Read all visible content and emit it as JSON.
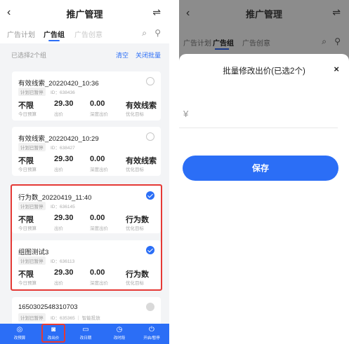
{
  "header": {
    "back_icon": "‹",
    "title": "推广管理",
    "swap_icon": "⇌"
  },
  "tabs": [
    {
      "label": "广告计划"
    },
    {
      "label": "广告组"
    },
    {
      "label": "广告创意"
    }
  ],
  "selection": {
    "count_text": "已选择2个组",
    "clear": "清空",
    "close": "关闭批量"
  },
  "cards": [
    {
      "name": "有效线索_20220420_10:36",
      "status": "计划已暂停",
      "id": "ID：638436",
      "budget": "不限",
      "budget_label": "今日预算",
      "bid": "29.30",
      "bid_label": "出价",
      "deep_bid": "0.00",
      "deep_label": "深度出价",
      "goal": "有效线索",
      "goal_label": "优化目标",
      "checked": false
    },
    {
      "name": "有效线索_20220420_10:29",
      "status": "计划已暂停",
      "id": "ID：638427",
      "budget": "不限",
      "budget_label": "今日预算",
      "bid": "29.30",
      "bid_label": "出价",
      "deep_bid": "0.00",
      "deep_label": "深度出价",
      "goal": "有效线索",
      "goal_label": "优化目标",
      "checked": false
    },
    {
      "name": "行为数_20220419_11:40",
      "status": "计划已暂停",
      "id": "ID：636145",
      "budget": "不限",
      "budget_label": "今日预算",
      "bid": "29.30",
      "bid_label": "出价",
      "deep_bid": "0.00",
      "deep_label": "深度出价",
      "goal": "行为数",
      "goal_label": "优化目标",
      "checked": true
    },
    {
      "name": "组图测试3",
      "status": "计划已暂停",
      "id": "ID：636113",
      "budget": "不限",
      "budget_label": "今日预算",
      "bid": "29.30",
      "bid_label": "出价",
      "deep_bid": "0.00",
      "deep_label": "深度出价",
      "goal": "行为数",
      "goal_label": "优化目标",
      "checked": true
    },
    {
      "name": "1650302548310703",
      "status": "计划已暂停",
      "id": "ID：635365 ｜ 智能投放",
      "checked": false,
      "disabled": true
    }
  ],
  "bottom_bar": [
    {
      "icon": "budget-icon",
      "glyph": "◎",
      "label": "改预算"
    },
    {
      "icon": "bid-icon",
      "glyph": "◙",
      "label": "改出价"
    },
    {
      "icon": "date-icon",
      "glyph": "▭",
      "label": "改日期"
    },
    {
      "icon": "time-icon",
      "glyph": "◷",
      "label": "改时段"
    },
    {
      "icon": "power-icon",
      "glyph": "⏻",
      "label": "开启/暂停"
    }
  ],
  "sheet": {
    "title": "批量修改出价(已选2个)",
    "close_icon": "×",
    "currency": "¥",
    "input_value": "",
    "save_label": "保存"
  },
  "toolbar_icons": {
    "search": "⌕",
    "filter": "⚲"
  },
  "colors": {
    "accent": "#2b6ef6",
    "highlight": "#e53935",
    "overlay": "#8c8c8c"
  }
}
